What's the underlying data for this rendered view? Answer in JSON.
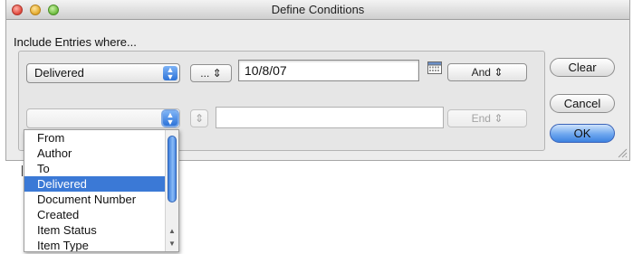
{
  "window": {
    "title": "Define Conditions",
    "include_label": "Include Entries where..."
  },
  "row1": {
    "field": "Delivered",
    "operator": "...",
    "value": "10/8/07",
    "connector": "And"
  },
  "row2": {
    "field": "",
    "operator": "",
    "value": "",
    "connector": "End"
  },
  "buttons": {
    "clear": "Clear",
    "cancel": "Cancel",
    "ok": "OK"
  },
  "field_list": {
    "items": [
      {
        "label": "From"
      },
      {
        "label": "Author"
      },
      {
        "label": "To"
      },
      {
        "label": "Delivered"
      },
      {
        "label": "Document Number"
      },
      {
        "label": "Created"
      },
      {
        "label": "Item Status"
      },
      {
        "label": "Item Type"
      }
    ],
    "selected": "Delivered"
  },
  "icons": {
    "popup_arrows": "up-down-chevron-icon",
    "calendar": "calendar-icon",
    "resize": "resize-grip-icon"
  },
  "colors": {
    "selection": "#3b79d6",
    "default_button": "#3d82e0"
  }
}
